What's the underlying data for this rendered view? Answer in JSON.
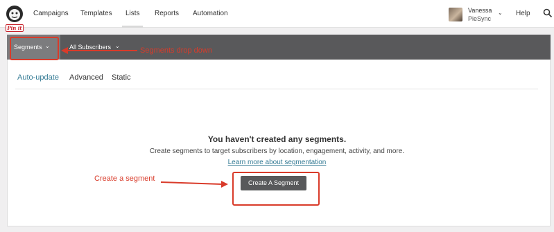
{
  "nav": {
    "items": [
      "Campaigns",
      "Templates",
      "Lists",
      "Reports",
      "Automation"
    ],
    "active": "Lists",
    "help_label": "Help"
  },
  "user": {
    "name": "Vanessa",
    "org": "PieSync"
  },
  "pinit_label": "Pin it",
  "subnav": {
    "segments_label": "Segments",
    "all_subscribers_label": "All Subscribers"
  },
  "tabs": [
    {
      "label": "Auto-update",
      "active": true
    },
    {
      "label": "Advanced",
      "active": false
    },
    {
      "label": "Static",
      "active": false
    }
  ],
  "empty_state": {
    "title": "You haven't created any segments.",
    "description": "Create segments to target subscribers by location, engagement, activity, and more.",
    "link": "Learn more about segmentation",
    "button": "Create A Segment"
  },
  "annotations": {
    "segments_dropdown": "Segments drop down",
    "create_segment": "Create a segment",
    "color": "#d93b2a"
  },
  "colors": {
    "accent": "#337a94",
    "subnav_bg": "#59595b",
    "button_bg": "#58595b"
  }
}
